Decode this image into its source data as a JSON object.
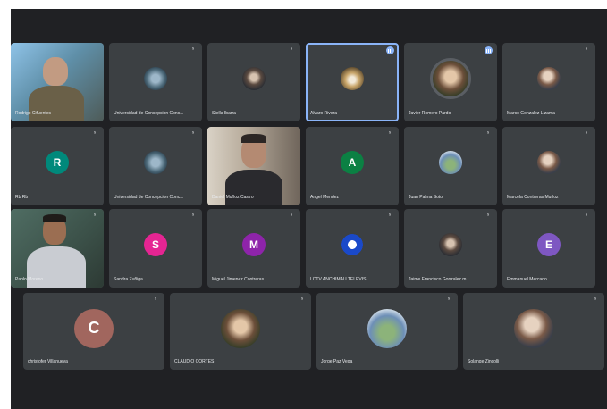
{
  "participants_row1": [
    {
      "name": "Rodrigo Cifuentes",
      "type": "video",
      "muted": false
    },
    {
      "name": "Universidad de Concepcion Conc...",
      "type": "photo",
      "muted": true
    },
    {
      "name": "Stella Ibarra",
      "type": "photo",
      "muted": true
    },
    {
      "name": "Alvaro Rivera",
      "type": "photo",
      "muted": false,
      "active": true,
      "speaking": true
    },
    {
      "name": "Javier Romero Pardo",
      "type": "photo",
      "muted": false,
      "speaking": true
    },
    {
      "name": "Marco Gonzalez Lizama",
      "type": "photo",
      "muted": true
    }
  ],
  "participants_row2": [
    {
      "name": "Rb Rb",
      "type": "initial",
      "initial": "R",
      "color": "#00897b",
      "muted": true
    },
    {
      "name": "Universidad de Concepcion Conc...",
      "type": "photo",
      "muted": true
    },
    {
      "name": "Daniel Muñoz Castro",
      "type": "video",
      "muted": false
    },
    {
      "name": "Angel Mendez",
      "type": "initial",
      "initial": "A",
      "color": "#0b8043",
      "muted": true
    },
    {
      "name": "Juan Palma Soto",
      "type": "photo",
      "muted": true
    },
    {
      "name": "Marcela Contreras Muñoz",
      "type": "photo",
      "muted": true
    }
  ],
  "participants_row3": [
    {
      "name": "Pablo Moreno",
      "type": "video",
      "muted": true
    },
    {
      "name": "Sandra Zuñiga",
      "type": "initial",
      "initial": "S",
      "color": "#e52592",
      "muted": true
    },
    {
      "name": "Miguel Jimenez Contreras",
      "type": "initial",
      "initial": "M",
      "color": "#8e24aa",
      "muted": true
    },
    {
      "name": "LCTV ANCHIMAU TELEVIS...",
      "type": "logo",
      "muted": true
    },
    {
      "name": "Jaime Francisco Gonzalez m...",
      "type": "photo",
      "muted": true
    },
    {
      "name": "Emmanuel Mercado",
      "type": "initial",
      "initial": "E",
      "color": "#7e57c2",
      "muted": true
    }
  ],
  "participants_row4": [
    {
      "name": "christofer Villanueva",
      "type": "initial",
      "initial": "C",
      "color": "#a1665e",
      "muted": true
    },
    {
      "name": "CLAUDIO CORTES",
      "type": "photo",
      "muted": true
    },
    {
      "name": "Jorge Paz Vega",
      "type": "photo",
      "muted": true
    },
    {
      "name": "Solange Zincolli",
      "type": "photo",
      "muted": true
    }
  ],
  "icons": {
    "muted": "mic-off-icon",
    "speaking": "audio-level-icon"
  },
  "colors": {
    "frame_bg": "#202124",
    "tile_bg": "#3c4043",
    "accent": "#8ab4f8"
  }
}
